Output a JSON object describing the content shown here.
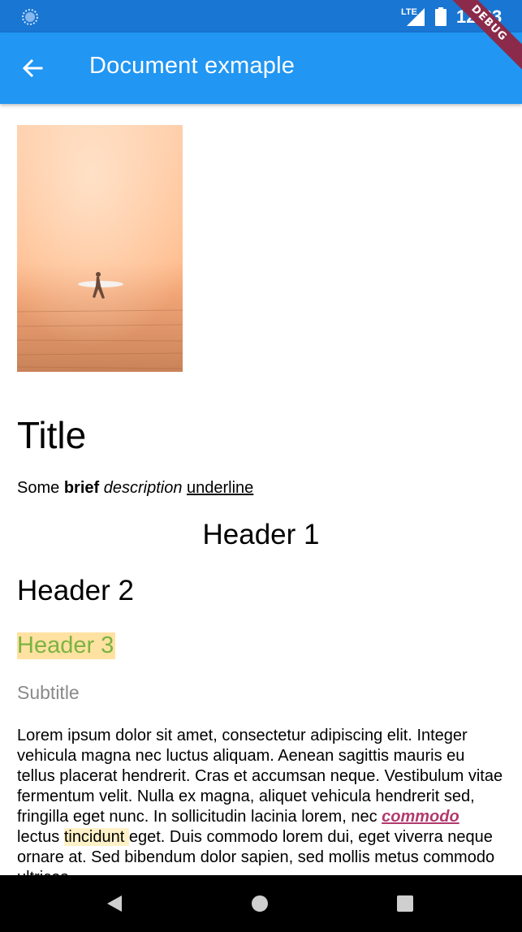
{
  "status_bar": {
    "network": "LTE",
    "time": "12:33"
  },
  "app_bar": {
    "title": "Document exmaple",
    "back_icon": "arrow-back-icon"
  },
  "debug_banner": "DEBUG",
  "document": {
    "image_alt": "surfer-on-beach-photo",
    "title": "Title",
    "description": {
      "some": "Some",
      "brief": "brief",
      "description": "description",
      "underline": "underline"
    },
    "header1": "Header 1",
    "header2": "Header 2",
    "header3": "Header 3",
    "subtitle": "Subtitle",
    "paragraph": {
      "part1": "Lorem ipsum dolor sit amet, consectetur adipiscing elit. Integer vehicula magna nec luctus aliquam. Aenean sagittis mauris eu tellus placerat hendrerit. Cras et accumsan neque. Vestibulum vitae fermentum velit. Nulla ex magna, aliquet vehicula hendrerit sed, fringilla eget nunc. In sollicitudin lacinia lorem, nec ",
      "link": "commodo ",
      "part2": "lectus ",
      "highlight": "tincidunt ",
      "part3": "eget. Duis commodo lorem dui, eget viverra neque ornare at. Sed bibendum dolor sapien, sed mollis metus commodo ultrices."
    }
  },
  "colors": {
    "status_bar": "#1976D2",
    "app_bar": "#2196F3",
    "header3_bg": "#FFE2A1",
    "header3_text": "#7CB342",
    "link": "#B23A6E",
    "highlight": "#FFF1C7"
  },
  "nav_bar": {
    "back": "nav-back-icon",
    "home": "nav-home-icon",
    "recents": "nav-recents-icon"
  }
}
